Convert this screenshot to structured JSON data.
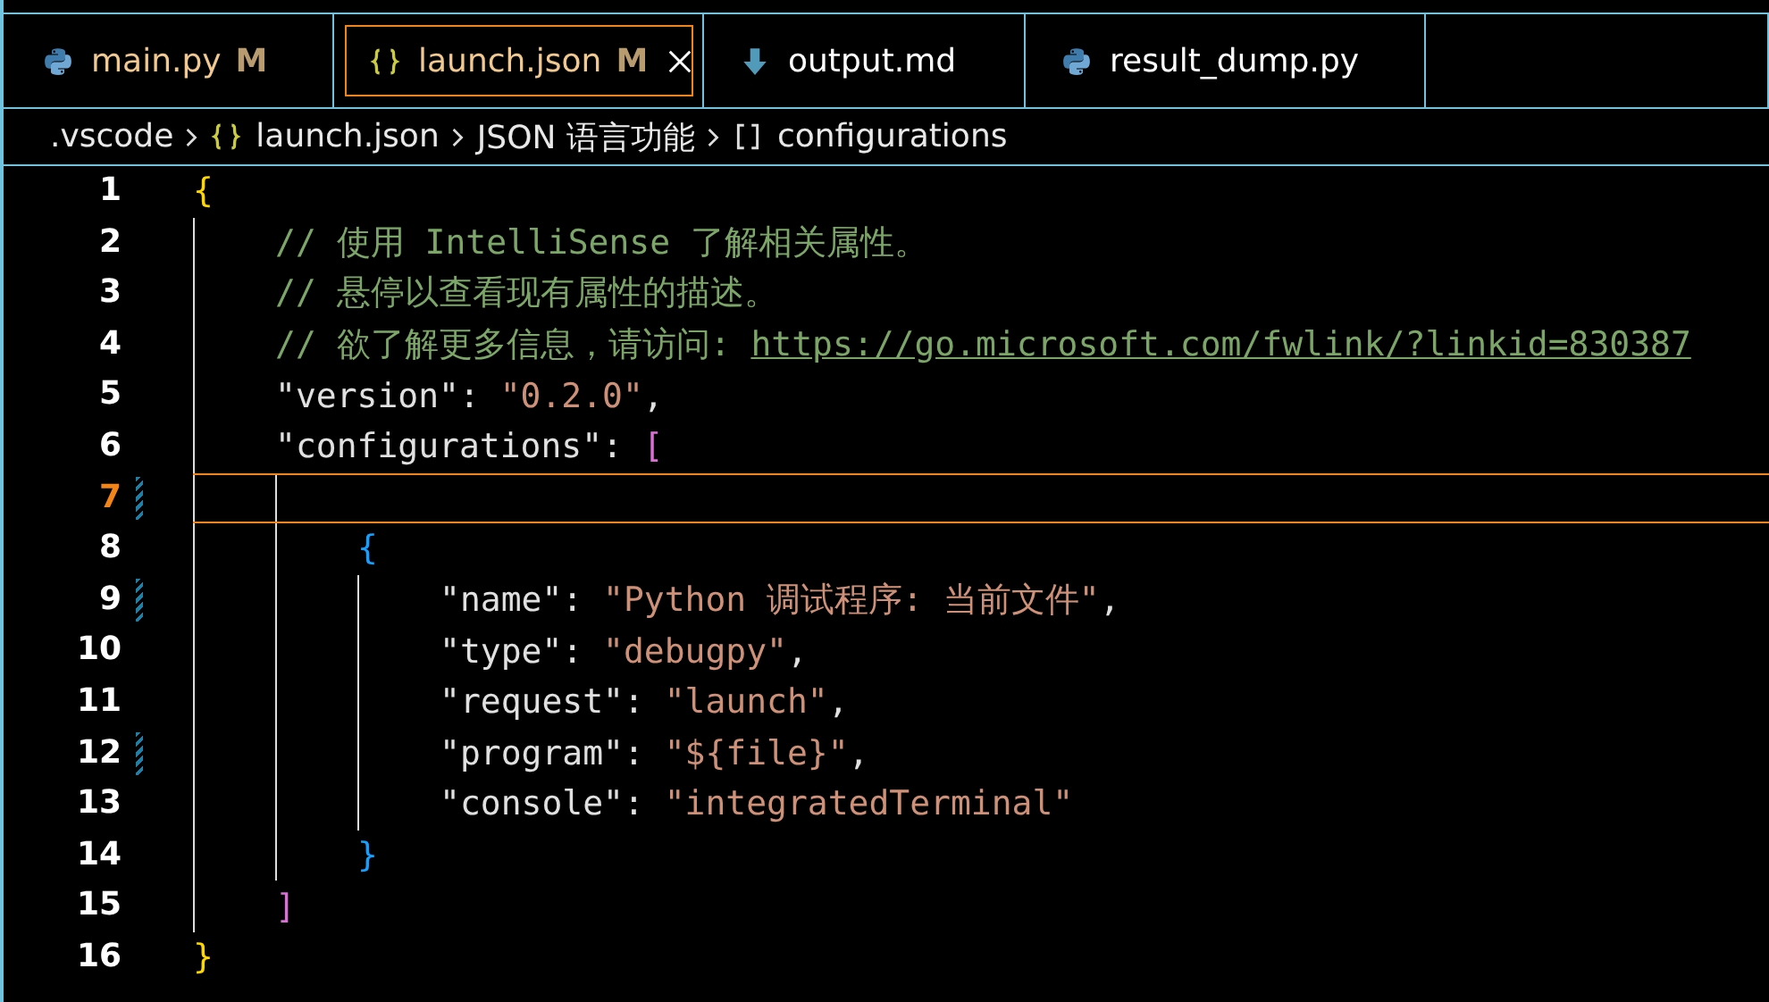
{
  "tabs": [
    {
      "label": "main.py",
      "kind": "python",
      "badge": "M",
      "selected": false
    },
    {
      "label": "launch.json",
      "kind": "json",
      "badge": "M",
      "selected": true
    },
    {
      "label": "output.md",
      "kind": "markdown",
      "selected": false
    },
    {
      "label": "result_dump.py",
      "kind": "python",
      "selected": false
    }
  ],
  "breadcrumbs": [
    {
      "label": ".vscode"
    },
    {
      "label": "launch.json",
      "kind": "json"
    },
    {
      "label": "JSON 语言功能"
    },
    {
      "label": "configurations",
      "kind": "array"
    }
  ],
  "lines": [
    {
      "number": "1",
      "tokens": [
        {
          "text": "{",
          "kind": "bracket",
          "color": "#ffd700"
        }
      ],
      "children": [
        {
          "number": "2",
          "tokens": [
            {
              "text": "// 使用 IntelliSense 了解相关属性。",
              "kind": "comment"
            }
          ]
        },
        {
          "number": "3",
          "tokens": [
            {
              "text": "// 悬停以查看现有属性的描述。",
              "kind": "comment"
            }
          ]
        },
        {
          "number": "4",
          "tokens": [
            {
              "text": "// 欲了解更多信息，请访问: ",
              "kind": "comment"
            },
            {
              "text": "https://go.microsoft.com/fwlink/?linkid=830387",
              "kind": "link"
            }
          ]
        },
        {
          "number": "5",
          "tokens": [
            {
              "text": "\"version\"",
              "kind": "key"
            },
            {
              "text": ": ",
              "kind": "punct"
            },
            {
              "text": "\"0.2.0\"",
              "kind": "string"
            },
            {
              "text": ",",
              "kind": "punct"
            }
          ]
        },
        {
          "number": "6",
          "tokens": [
            {
              "text": "\"configurations\"",
              "kind": "key"
            },
            {
              "text": ": ",
              "kind": "punct"
            },
            {
              "text": "[",
              "kind": "bracket",
              "color": "#da70d6"
            }
          ],
          "children": [
            {
              "number": "7",
              "current": true,
              "modified": true
            },
            {
              "number": "8",
              "tokens": [
                {
                  "text": "{",
                  "kind": "bracket",
                  "color": "#179fff"
                }
              ],
              "children": [
                {
                  "number": "9",
                  "modified": true,
                  "tokens": [
                    {
                      "text": "\"name\"",
                      "kind": "key"
                    },
                    {
                      "text": ": ",
                      "kind": "punct"
                    },
                    {
                      "text": "\"Python 调试程序: 当前文件\"",
                      "kind": "string"
                    },
                    {
                      "text": ",",
                      "kind": "punct"
                    }
                  ]
                },
                {
                  "number": "10",
                  "tokens": [
                    {
                      "text": "\"type\"",
                      "kind": "key"
                    },
                    {
                      "text": ": ",
                      "kind": "punct"
                    },
                    {
                      "text": "\"debugpy\"",
                      "kind": "string"
                    },
                    {
                      "text": ",",
                      "kind": "punct"
                    }
                  ]
                },
                {
                  "number": "11",
                  "tokens": [
                    {
                      "text": "\"request\"",
                      "kind": "key"
                    },
                    {
                      "text": ": ",
                      "kind": "punct"
                    },
                    {
                      "text": "\"launch\"",
                      "kind": "string"
                    },
                    {
                      "text": ",",
                      "kind": "punct"
                    }
                  ]
                },
                {
                  "number": "12",
                  "modified": true,
                  "tokens": [
                    {
                      "text": "\"program\"",
                      "kind": "key"
                    },
                    {
                      "text": ": ",
                      "kind": "punct"
                    },
                    {
                      "text": "\"${file}\"",
                      "kind": "string"
                    },
                    {
                      "text": ",",
                      "kind": "punct"
                    }
                  ]
                },
                {
                  "number": "13",
                  "tokens": [
                    {
                      "text": "\"console\"",
                      "kind": "key"
                    },
                    {
                      "text": ": ",
                      "kind": "punct"
                    },
                    {
                      "text": "\"integratedTerminal\"",
                      "kind": "string"
                    }
                  ]
                }
              ]
            },
            {
              "number": "14",
              "tokens": [
                {
                  "text": "}",
                  "kind": "bracket",
                  "color": "#179fff"
                }
              ]
            }
          ]
        },
        {
          "number": "15",
          "tokens": [
            {
              "text": "]",
              "kind": "bracket",
              "color": "#da70d6"
            }
          ]
        }
      ]
    },
    {
      "number": "16",
      "tokens": [
        {
          "text": "}",
          "kind": "bracket",
          "color": "#ffd700"
        }
      ]
    }
  ]
}
